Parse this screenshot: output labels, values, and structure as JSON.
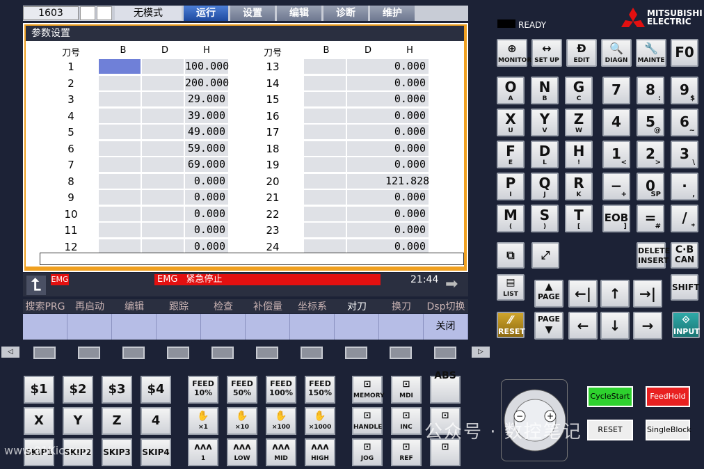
{
  "topbar": {
    "program": "1603",
    "mode": "无模式",
    "tabs": [
      "运行",
      "设置",
      "编辑",
      "诊断",
      "维护"
    ]
  },
  "panel": {
    "title": "参数设置",
    "headers": [
      "刀号",
      "B",
      "D",
      "H",
      "刀号",
      "B",
      "D",
      "H"
    ],
    "left": [
      [
        "1",
        "100.000"
      ],
      [
        "2",
        "200.000"
      ],
      [
        "3",
        "29.000"
      ],
      [
        "4",
        "39.000"
      ],
      [
        "5",
        "49.000"
      ],
      [
        "6",
        "59.000"
      ],
      [
        "7",
        "69.000"
      ],
      [
        "8",
        "0.000"
      ],
      [
        "9",
        "0.000"
      ],
      [
        "10",
        "0.000"
      ],
      [
        "11",
        "0.000"
      ],
      [
        "12",
        "0.000"
      ]
    ],
    "right": [
      [
        "13",
        "0.000"
      ],
      [
        "14",
        "0.000"
      ],
      [
        "15",
        "0.000"
      ],
      [
        "16",
        "0.000"
      ],
      [
        "17",
        "0.000"
      ],
      [
        "18",
        "0.000"
      ],
      [
        "19",
        "0.000"
      ],
      [
        "20",
        "121.828"
      ],
      [
        "21",
        "0.000"
      ],
      [
        "22",
        "0.000"
      ],
      [
        "23",
        "0.000"
      ],
      [
        "24",
        "0.000"
      ]
    ]
  },
  "alarm": {
    "tag": "EMG",
    "tag2": "EMG",
    "message": "紧急停止",
    "time": "21:44"
  },
  "softkeys": {
    "labels": [
      "搜索PRG",
      "再启动",
      "编辑",
      "跟踪",
      "检查",
      "补偿量",
      "坐标系",
      "对刀",
      "换刀",
      "Dsp切换"
    ],
    "buttons": [
      "",
      "",
      "",
      "",
      "",
      "",
      "",
      "",
      "",
      "关闭"
    ]
  },
  "status": {
    "ready": "READY",
    "brand1": "MITSUBISHI",
    "brand2": "ELECTRIC"
  },
  "func_keys": [
    [
      "MONITOR",
      "⊕"
    ],
    [
      "SET UP",
      "↔"
    ],
    [
      "EDIT",
      "Ð"
    ],
    [
      "DIAGN",
      "🔍"
    ],
    [
      "MAINTE",
      "🔧"
    ]
  ],
  "f0": "F0",
  "alpha": [
    [
      "O",
      "A"
    ],
    [
      "N",
      "B"
    ],
    [
      "G",
      "C"
    ],
    [
      "X",
      "U"
    ],
    [
      "Y",
      "V"
    ],
    [
      "Z",
      "W"
    ],
    [
      "F",
      "E"
    ],
    [
      "D",
      "L"
    ],
    [
      "H",
      "!"
    ],
    [
      "P",
      "I"
    ],
    [
      "Q",
      "J"
    ],
    [
      "R",
      "K"
    ],
    [
      "M",
      "("
    ],
    [
      "S",
      ")"
    ],
    [
      "T",
      "["
    ]
  ],
  "nums": [
    [
      "7",
      ""
    ],
    [
      "8",
      ":"
    ],
    [
      "9",
      "$"
    ],
    [
      "4",
      ""
    ],
    [
      "5",
      "@"
    ],
    [
      "6",
      "~"
    ],
    [
      "1",
      "<"
    ],
    [
      "2",
      ">"
    ],
    [
      "3",
      "\\"
    ],
    [
      "−",
      "+"
    ],
    [
      "0",
      "SP"
    ],
    [
      "·",
      ","
    ],
    [
      "EOB",
      "]"
    ],
    [
      "=",
      "#"
    ],
    [
      "/",
      "*"
    ]
  ],
  "edit_keys": {
    "delete": "DELETE",
    "insert": "INSERT",
    "cb": "C·B",
    "can": "CAN",
    "shift": "SHIFT",
    "list": "LIST",
    "page": "PAGE",
    "reset": "RESET",
    "input": "INPUT"
  },
  "bottom": {
    "row1": [
      "$1",
      "$2",
      "$3",
      "$4"
    ],
    "row2": [
      "X",
      "Y",
      "Z",
      "4"
    ],
    "row3": [
      "SKIP1",
      "SKIP2",
      "SKIP3",
      "SKIP4"
    ],
    "feed": [
      [
        "FEED",
        "10%"
      ],
      [
        "FEED",
        "50%"
      ],
      [
        "FEED",
        "100%"
      ],
      [
        "FEED",
        "150%"
      ]
    ],
    "hand": [
      "×1",
      "×10",
      "×100",
      "×1000"
    ],
    "step": [
      "1",
      "LOW",
      "MID",
      "HIGH"
    ],
    "modes": [
      "MEMORY",
      "MDI",
      "ABS",
      "HANDLE",
      "INC",
      "",
      "JOG",
      "REF",
      ""
    ]
  },
  "buttons": {
    "cycle": "CycleStart",
    "feed": "FeedHold",
    "reset": "RESET",
    "single": "SingleBlock"
  },
  "watermark": "公众号 · 数控笔记",
  "watermark2": "www.91Kic.com"
}
